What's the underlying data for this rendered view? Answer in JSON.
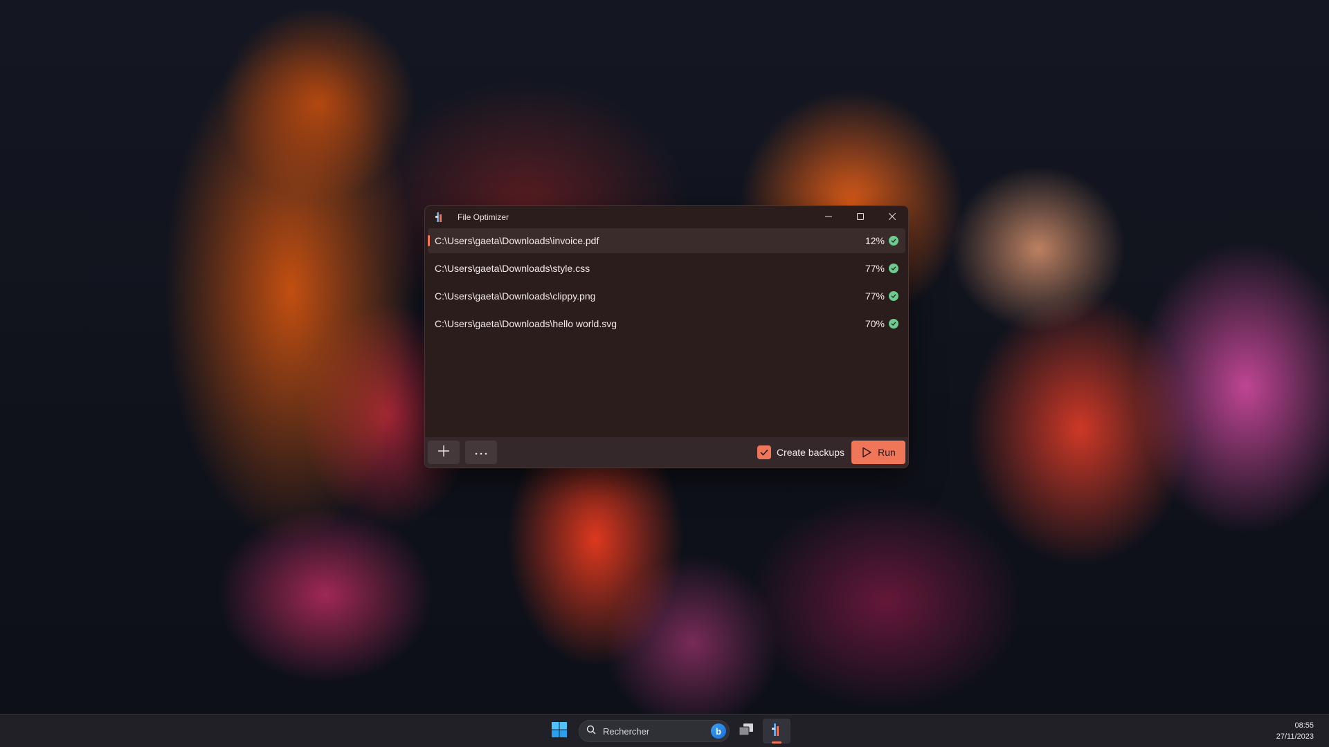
{
  "window": {
    "title": "File Optimizer",
    "accent_color": "#f0765a",
    "caption_buttons": [
      "minimize-icon",
      "maximize-icon",
      "close-icon"
    ]
  },
  "files": [
    {
      "path": "C:\\Users\\gaeta\\Downloads\\invoice.pdf",
      "percent": "12%",
      "status": "done",
      "selected": true
    },
    {
      "path": "C:\\Users\\gaeta\\Downloads\\style.css",
      "percent": "77%",
      "status": "done",
      "selected": false
    },
    {
      "path": "C:\\Users\\gaeta\\Downloads\\clippy.png",
      "percent": "77%",
      "status": "done",
      "selected": false
    },
    {
      "path": "C:\\Users\\gaeta\\Downloads\\hello world.svg",
      "percent": "70%",
      "status": "done",
      "selected": false
    }
  ],
  "toolbar": {
    "add_icon": "plus-icon",
    "more_icon": "more-icon",
    "create_backups_label": "Create backups",
    "create_backups_checked": true,
    "run_label": "Run",
    "run_icon": "play-icon"
  },
  "taskbar": {
    "search_placeholder": "Rechercher",
    "time": "08:55",
    "date": "27/11/2023"
  }
}
